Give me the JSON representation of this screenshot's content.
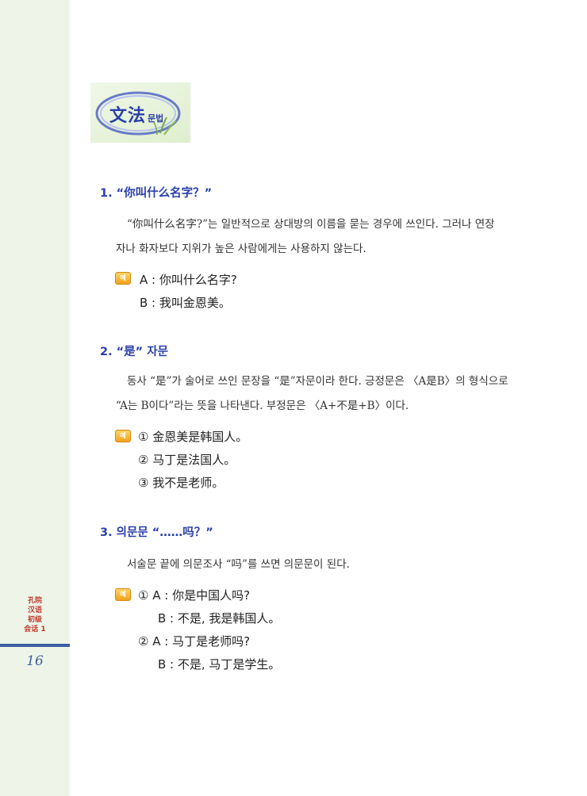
{
  "sidebar": {
    "series_lines": [
      "孔院",
      "汉语",
      "初级",
      "会话 1"
    ],
    "page_number": "16"
  },
  "logo": {
    "chinese": "文法",
    "korean": "문법"
  },
  "sections": [
    {
      "heading": "1. “你叫什么名字？”",
      "paragraph_line1": "“你叫什么名字?”는 일반적으로 상대방의 이름을 묻는 경우에 쓰인다. 그러나 연장",
      "paragraph_line2": "자나 화자보다 지위가 높은 사람에게는 사용하지 않는다.",
      "examples": [
        "A : 你叫什么名字?",
        "B : 我叫金恩美。"
      ]
    },
    {
      "heading": "2. “是” 자문",
      "paragraph_line1": "동사 “是”가 술어로 쓰인 문장을 “是”자문이라 한다. 긍정문은 〈A是B〉의 형식으로",
      "paragraph_line2": "“A는 B이다”라는 뜻을 나타낸다. 부정문은 〈A+不是+B〉이다.",
      "examples": [
        "① 金恩美是韩国人。",
        "② 马丁是法国人。",
        "③ 我不是老师。"
      ]
    },
    {
      "heading": "3. 의문문 “……吗？”",
      "paragraph_line1": "서술문 끝에 의문조사 “吗”를 쓰면 의문문이 된다.",
      "examples": [
        "①   A : 你是中国人吗?",
        "B : 不是, 我是韩国人。",
        "②   A : 马丁是老师吗?",
        "B : 不是, 马丁是学生。"
      ]
    }
  ],
  "example_icon_label": "예"
}
